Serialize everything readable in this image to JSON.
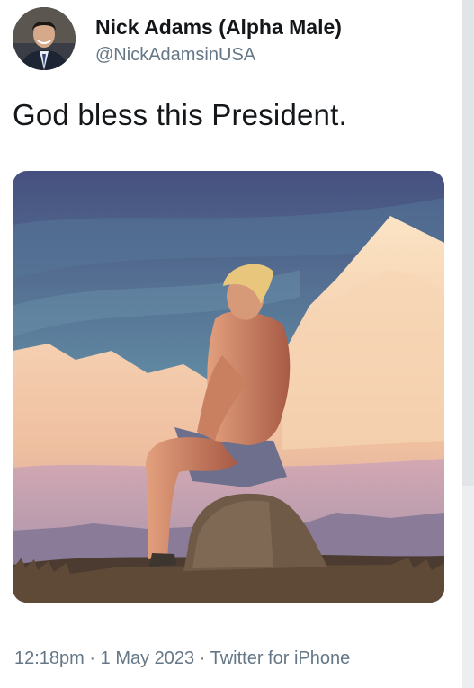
{
  "tweet": {
    "display_name": "Nick Adams (Alpha Male)",
    "handle": "@NickAdamsinUSA",
    "text": "God bless this President.",
    "time": "12:18pm",
    "separator": "·",
    "date": "1 May 2023",
    "source": "Twitter for iPhone"
  },
  "media": {
    "icon": "illustration-image"
  },
  "colors": {
    "text_primary": "#14171a",
    "text_secondary": "#657786"
  }
}
